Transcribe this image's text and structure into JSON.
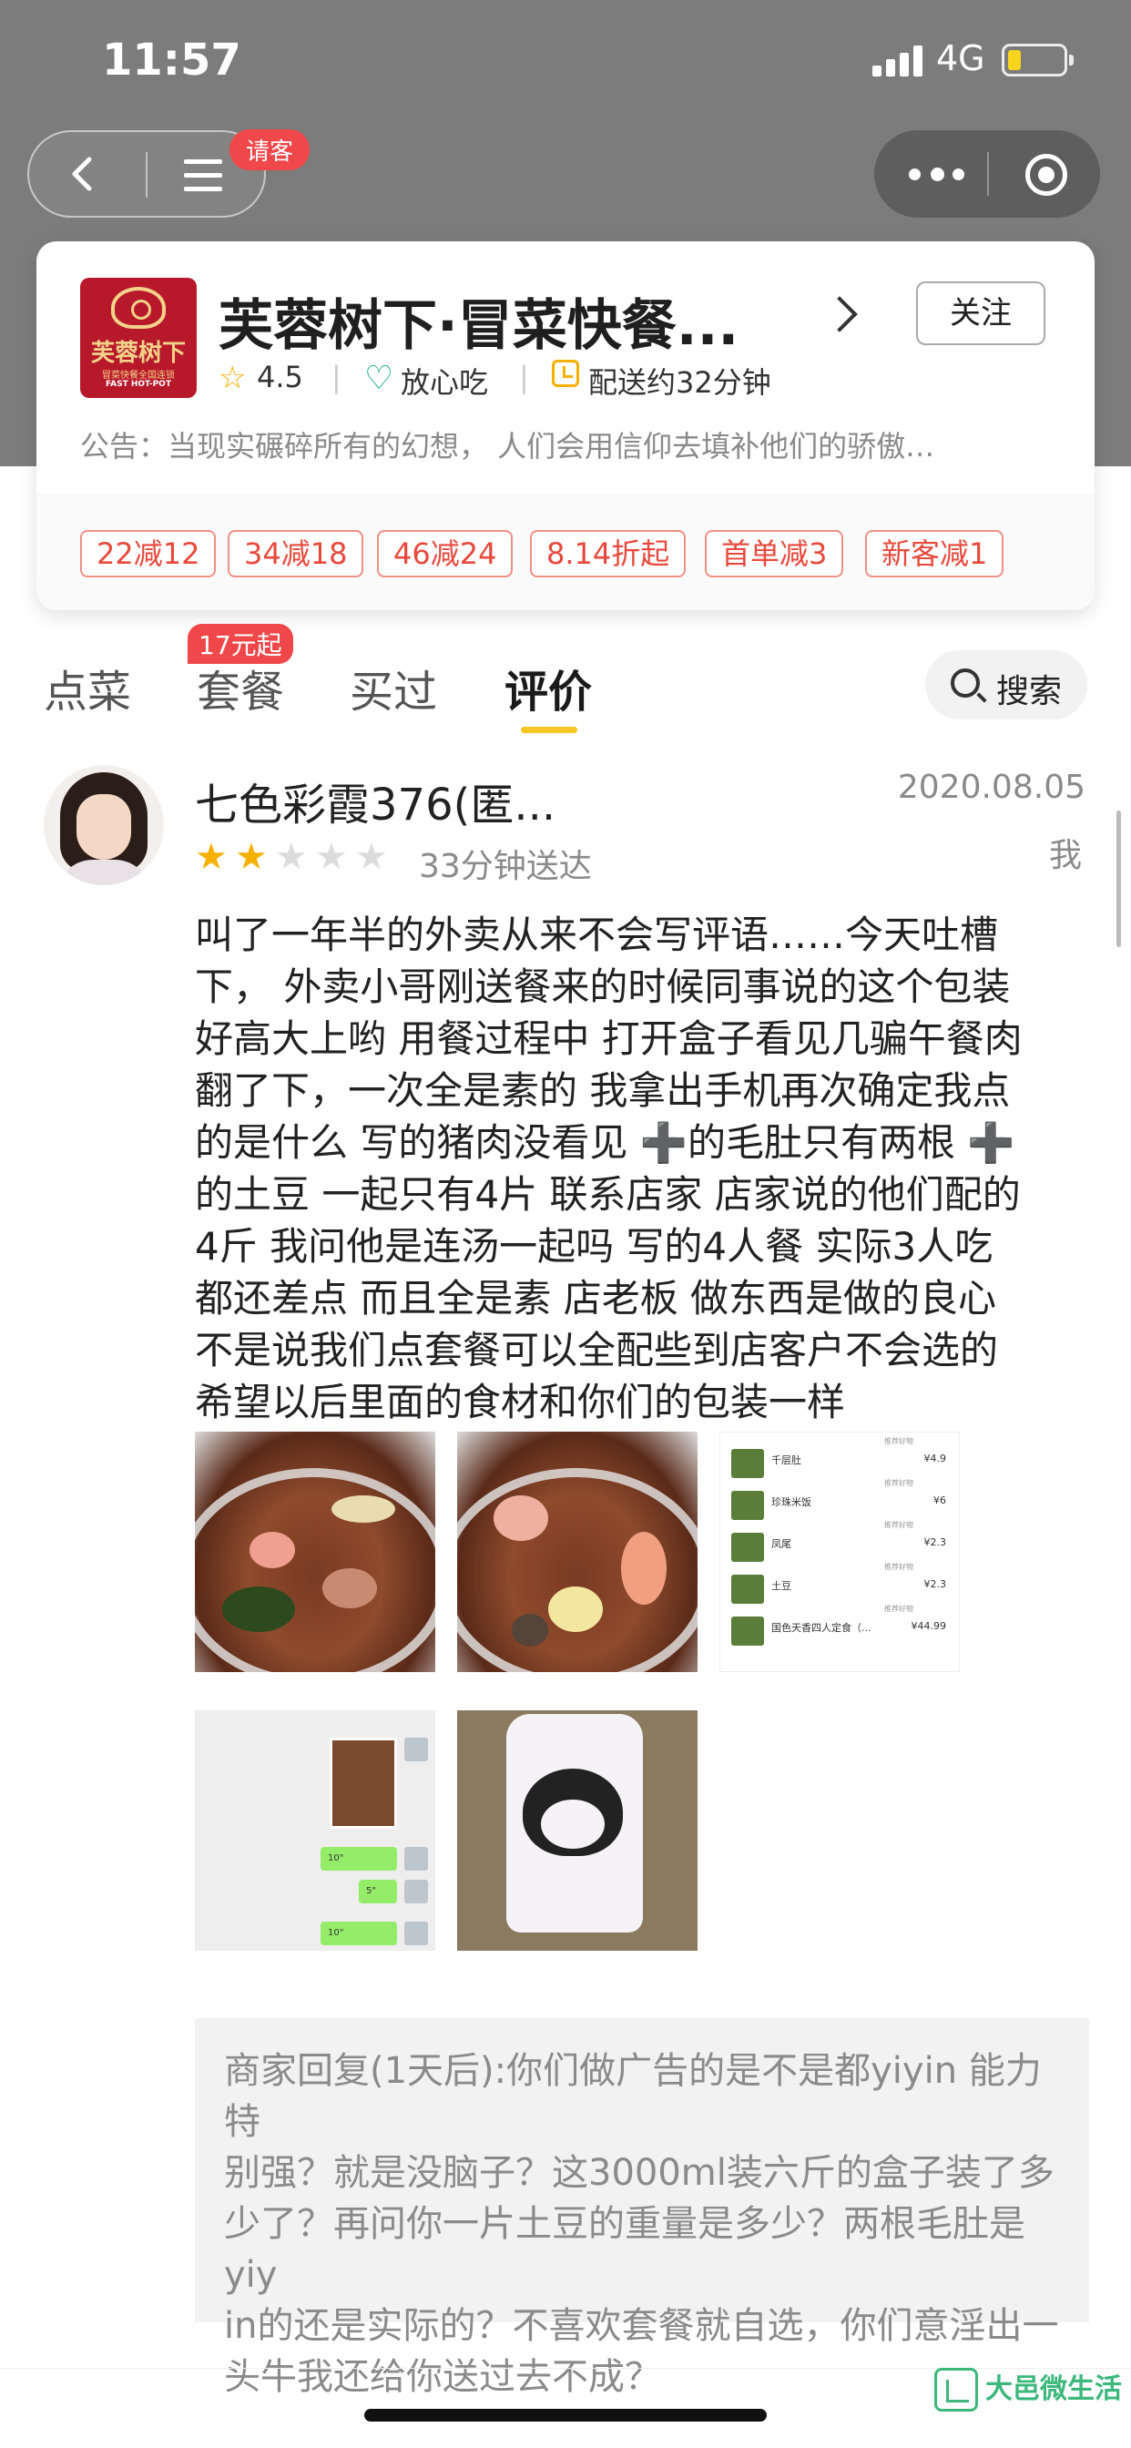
{
  "status_bar": {
    "time": "11:57",
    "network": "4G"
  },
  "nav": {
    "treat_badge": "请客"
  },
  "shop": {
    "logo_text": "芙蓉树下",
    "logo_subtext": "冒菜快餐全国连锁",
    "logo_english": "FAST HOT-POT",
    "name": "芙蓉树下·冒菜快餐...",
    "follow_label": "关注",
    "rating": "4.5",
    "safe_label": "放心吃",
    "delivery": "配送约32分钟",
    "notice": "公告：当现实碾碎所有的幻想， 人们会用信仰去填补他们的骄傲…",
    "promotions": [
      "22减12",
      "34减18",
      "46减24",
      "8.14折起",
      "首单减3",
      "新客减1"
    ]
  },
  "tabs": {
    "items": [
      "点菜",
      "套餐",
      "买过",
      "评价"
    ],
    "active": "评价",
    "badge": "17元起",
    "search_label": "搜索"
  },
  "review": {
    "reviewer": "七色彩霞376(匿...",
    "date": "2020.08.05",
    "me_label": "我",
    "rating_stars": 2,
    "max_stars": 5,
    "delivery_time": "33分钟送达",
    "text": "叫了一年半的外卖从来不会写评语……今天吐槽\n下， 外卖小哥刚送餐来的时候同事说的这个包装\n好高大上哟 用餐过程中 打开盒子看见几骗午餐肉\n翻了下，一次全是素的 我拿出手机再次确定我点\n的是什么 写的猪肉没看见 ➕的毛肚只有两根 ➕\n的土豆 一起只有4片 联系店家 店家说的他们配的\n4斤 我问他是连汤一起吗 写的4人餐 实际3人吃\n都还差点 而且全是素 店老板 做东西是做的良心\n不是说我们点套餐可以全配些到店客户不会选的\n希望以后里面的食材和你们的包装一样",
    "photos": [
      "food-photo-1",
      "food-photo-2",
      "menu-screenshot",
      "chat-screenshot",
      "bag-photo"
    ],
    "menu_items": [
      {
        "name": "千层肚",
        "price": "¥4.9"
      },
      {
        "name": "珍珠米饭",
        "price": "¥6"
      },
      {
        "name": "凤尾",
        "price": "¥2.3"
      },
      {
        "name": "土豆",
        "price": "¥2.3"
      },
      {
        "name": "国色天香四人定食（...",
        "price": "¥44.99"
      }
    ],
    "menu_tag": "推荐好物",
    "chat_bubbles": [
      "10\"",
      "5\"",
      "10\""
    ],
    "reply": "商家回复(1天后):你们做广告的是不是都yiyin 能力特\n别强？就是没脑子？这3000ml装六斤的盒子装了多\n少了？再问你一片土豆的重量是多少？两根毛肚是yiy\nin的还是实际的？不喜欢套餐就自选，你们意淫出一\n头牛我还给你送过去不成？"
  },
  "watermark": {
    "text": "大邑微生活"
  },
  "colors": {
    "accent_yellow": "#f6c624",
    "promo_red": "#e8493c",
    "badge_red": "#f0484a",
    "brand_green": "#1aad8e"
  }
}
